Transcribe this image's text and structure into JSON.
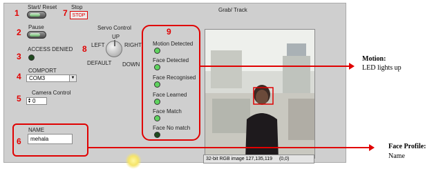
{
  "panel": {
    "start_reset_label": "Start/ Reset",
    "stop_label": "Stop",
    "stop_button_text": "STOP",
    "pause_label": "Pause",
    "access_denied_label": "ACCESS DENIED",
    "comport_label": "COMPORT",
    "comport_value": "COM3",
    "camera_control_label": "Camera Control",
    "camera_control_value": "0",
    "name_label": "NAME",
    "name_value": "mehala",
    "servo_control_label": "Servo Control",
    "servo_up": "UP",
    "servo_left": "LEFT",
    "servo_right": "RIGHT",
    "servo_default": "DEFAULT",
    "servo_down": "DOWN",
    "grab_track_label": "Grab/ Track",
    "status_text": "32-bit RGB image 127,135,119",
    "status_coords": "(0,0)"
  },
  "numbers": {
    "n1": "1",
    "n2": "2",
    "n3": "3",
    "n4": "4",
    "n5": "5",
    "n6": "6",
    "n7": "7",
    "n8": "8",
    "n9": "9"
  },
  "indicators": [
    {
      "label": "Motion Detected",
      "state": "on"
    },
    {
      "label": "Face Detected",
      "state": "on"
    },
    {
      "label": "Face Recognised",
      "state": "on"
    },
    {
      "label": "Face Learned",
      "state": "on"
    },
    {
      "label": "Face Match",
      "state": "on"
    },
    {
      "label": "Face No match",
      "state": "off"
    }
  ],
  "annotations": {
    "motion_title": "Motion:",
    "motion_text": "LED lights up",
    "face_profile_title": "Face Profile:",
    "face_profile_text": "Name"
  },
  "colors": {
    "led_on": "#5fd35f",
    "led_off": "#1f4a1f",
    "highlight_red": "#e00000"
  }
}
